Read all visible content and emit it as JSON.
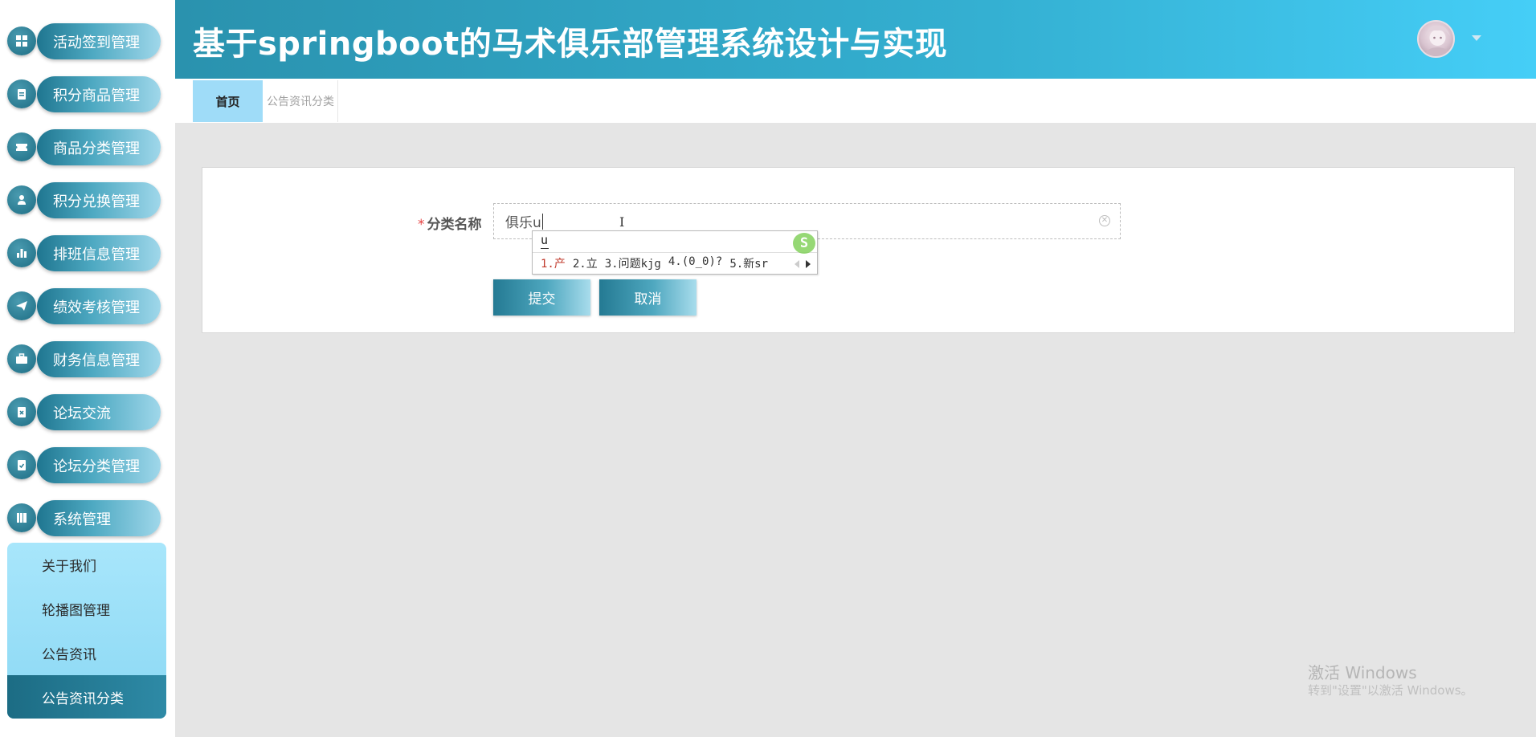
{
  "header": {
    "title": "基于springboot的马术俱乐部管理系统设计与实现"
  },
  "sidebar": {
    "items": [
      {
        "label": "活动签到管理",
        "icon": "grid-icon"
      },
      {
        "label": "积分商品管理",
        "icon": "clipboard-icon"
      },
      {
        "label": "商品分类管理",
        "icon": "ticket-icon"
      },
      {
        "label": "积分兑换管理",
        "icon": "user-icon"
      },
      {
        "label": "排班信息管理",
        "icon": "bar-chart-icon"
      },
      {
        "label": "绩效考核管理",
        "icon": "paper-plane-icon"
      },
      {
        "label": "财务信息管理",
        "icon": "briefcase-icon"
      },
      {
        "label": "论坛交流",
        "icon": "clipboard-x-icon"
      },
      {
        "label": "论坛分类管理",
        "icon": "clipboard-check-icon"
      },
      {
        "label": "系统管理",
        "icon": "book-icon"
      }
    ],
    "submenu": [
      {
        "label": "关于我们"
      },
      {
        "label": "轮播图管理"
      },
      {
        "label": "公告资讯"
      },
      {
        "label": "公告资讯分类",
        "active": true
      }
    ]
  },
  "tabs": [
    {
      "label": "首页",
      "active": true
    },
    {
      "label": "公告资讯分类"
    }
  ],
  "form": {
    "required_mark": "*",
    "label": "分类名称",
    "value": "俱乐u",
    "submit_label": "提交",
    "cancel_label": "取消"
  },
  "ime": {
    "composition": "u",
    "candidates": [
      "1.产",
      "2.立",
      "3.问题kjg",
      "4.(0_0)?",
      "5.新sr"
    ],
    "logo": "S"
  },
  "watermark": {
    "line1": "激活 Windows",
    "line2": "转到\"设置\"以激活 Windows。"
  },
  "colors": {
    "header_start": "#2a92ae",
    "header_end": "#45cef7",
    "menu_dark": "#1f7690",
    "submenu_bg": "#a8e6fb",
    "active_tab": "#9fdcf8",
    "required": "#e64242"
  }
}
